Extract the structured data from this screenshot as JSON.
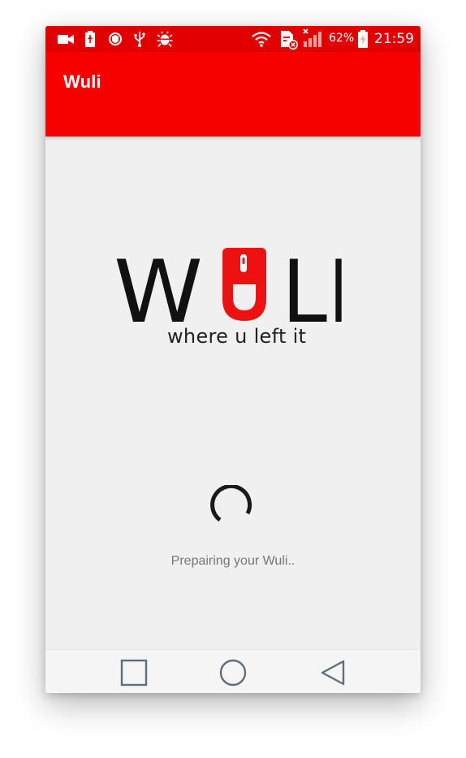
{
  "status_bar": {
    "battery_percent": "62%",
    "time": "21:59",
    "icons": [
      "video-camera-icon",
      "battery-usb-icon",
      "shield-icon",
      "usb-icon",
      "bug-icon",
      "wifi-icon",
      "sim-error-icon",
      "signal-icon",
      "battery-icon"
    ],
    "color": "#e00000"
  },
  "app_bar": {
    "title": "Wuli",
    "color": "#f70000"
  },
  "logo": {
    "letters": [
      "W",
      "L",
      "I"
    ],
    "tagline": "where u left it",
    "accent_color": "#ee1111"
  },
  "loading": {
    "message": "Prepairing your Wuli.."
  },
  "nav_bar": {
    "buttons": [
      "recents-icon",
      "home-icon",
      "back-icon"
    ]
  }
}
